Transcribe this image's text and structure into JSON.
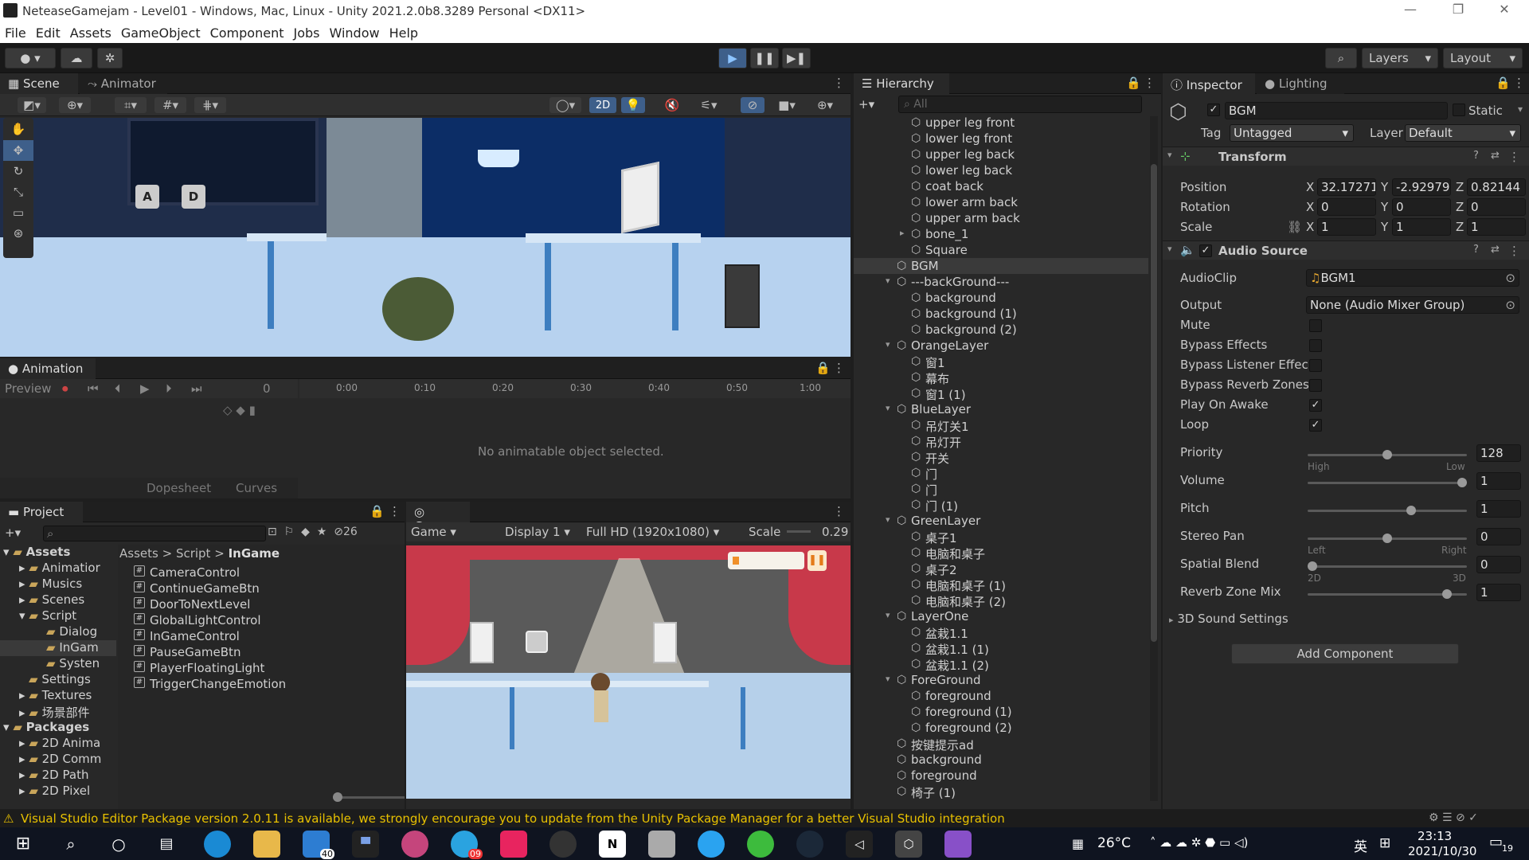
{
  "window": {
    "title": "NeteaseGamejam - Level01 - Windows, Mac, Linux - Unity 2021.2.0b8.3289 Personal <DX11>"
  },
  "menu": [
    "File",
    "Edit",
    "Assets",
    "GameObject",
    "Component",
    "Jobs",
    "Window",
    "Help"
  ],
  "toolbar": {
    "layers": "Layers",
    "layout": "Layout"
  },
  "scene": {
    "tab_scene": "Scene",
    "tab_animator": "Animator",
    "btn_2d": "2D",
    "key_a": "A",
    "key_d": "D"
  },
  "animation": {
    "tab": "Animation",
    "preview": "Preview",
    "frame": "0",
    "timeline": [
      "0:00",
      "0:10",
      "0:20",
      "0:30",
      "0:40",
      "0:50",
      "1:00"
    ],
    "empty": "No animatable object selected.",
    "dopesheet": "Dopesheet",
    "curves": "Curves"
  },
  "project": {
    "tab": "Project",
    "count": "26",
    "breadcrumb": [
      "Assets",
      "Script",
      "InGame"
    ],
    "tree": [
      "Assets",
      "Animatior",
      "Musics",
      "Scenes",
      "Script",
      "Dialog",
      "InGam",
      "Systen",
      "Settings",
      "Textures",
      "场景部件",
      "Packages",
      "2D Anima",
      "2D Comm",
      "2D Path",
      "2D Pixel"
    ],
    "files": [
      "CameraControl",
      "ContinueGameBtn",
      "DoorToNextLevel",
      "GlobalLightControl",
      "InGameControl",
      "PauseGameBtn",
      "PlayerFloatingLight",
      "TriggerChangeEmotion"
    ]
  },
  "game": {
    "tab": "Game",
    "display_mode": "Game",
    "display": "Display 1",
    "resolution": "Full HD (1920x1080)",
    "scale_label": "Scale",
    "scale_value": "0.29"
  },
  "hierarchy": {
    "tab": "Hierarchy",
    "search_placeholder": "All",
    "rows": [
      "upper leg front",
      "lower leg front",
      "upper leg back",
      "lower leg back",
      "coat back",
      "lower arm back",
      "upper arm back",
      "bone_1",
      "Square",
      "BGM",
      "---backGround---",
      "background",
      "background (1)",
      "background (2)",
      "OrangeLayer",
      "窗1",
      "幕布",
      "窗1 (1)",
      "BlueLayer",
      "吊灯关1",
      "吊灯开",
      "开关",
      "门",
      "门",
      "门 (1)",
      "GreenLayer",
      "桌子1",
      "电脑和桌子",
      "桌子2",
      "电脑和桌子 (1)",
      "电脑和桌子 (2)",
      "LayerOne",
      "盆栽1.1",
      "盆栽1.1 (1)",
      "盆栽1.1 (2)",
      "ForeGround",
      "foreground",
      "foreground (1)",
      "foreground (2)",
      "按键提示ad",
      "background",
      "foreground",
      "椅子 (1)"
    ]
  },
  "inspector": {
    "tab": "Inspector",
    "tab2": "Lighting",
    "name": "BGM",
    "static": "Static",
    "tag_label": "Tag",
    "tag": "Untagged",
    "layer_label": "Layer",
    "layer": "Default",
    "transform": {
      "title": "Transform",
      "position": "Position",
      "rotation": "Rotation",
      "scale": "Scale",
      "pos": [
        "32.17271",
        "-2.92979",
        "0.82144"
      ],
      "rot": [
        "0",
        "0",
        "0"
      ],
      "scl": [
        "1",
        "1",
        "1"
      ]
    },
    "audio": {
      "title": "Audio Source",
      "clip_label": "AudioClip",
      "clip": "BGM1",
      "output_label": "Output",
      "output": "None (Audio Mixer Group)",
      "mute": "Mute",
      "bypass_effects": "Bypass Effects",
      "bypass_listener": "Bypass Listener Effec",
      "bypass_reverb": "Bypass Reverb Zones",
      "play_on_awake": "Play On Awake",
      "loop": "Loop",
      "priority": "Priority",
      "priority_value": "128",
      "priority_level": 0.5,
      "high": "High",
      "low": "Low",
      "volume": "Volume",
      "volume_value": "1",
      "volume_level": 1,
      "pitch": "Pitch",
      "pitch_value": "1",
      "pitch_level": 0.66,
      "stereo": "Stereo Pan",
      "stereo_value": "0",
      "stereo_level": 0.5,
      "left": "Left",
      "right": "Right",
      "spatial": "Spatial Blend",
      "spatial_value": "0",
      "spatial_level": 0,
      "s2d": "2D",
      "s3d": "3D",
      "reverb": "Reverb Zone Mix",
      "reverb_value": "1",
      "reverb_level": 0.9,
      "sound3d": "3D Sound Settings"
    },
    "add_component": "Add Component"
  },
  "status": {
    "message": "Visual Studio Editor Package version 2.0.11 is available, we strongly encourage you to update from the Unity Package Manager for a better Visual Studio integration"
  },
  "taskbar": {
    "temp": "26°C",
    "ime": "英",
    "time": "23:13",
    "date": "2021/10/30",
    "mail_badge": "40",
    "tg_badge": "09",
    "qq_badge": "19"
  }
}
